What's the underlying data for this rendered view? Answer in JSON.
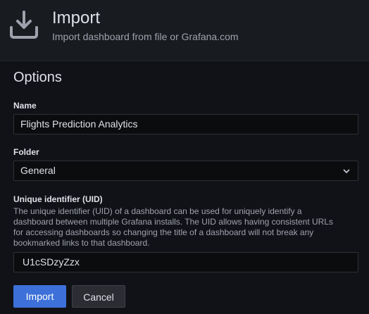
{
  "header": {
    "icon": "download-icon",
    "title": "Import",
    "subtitle": "Import dashboard from file or Grafana.com"
  },
  "options": {
    "title": "Options",
    "name": {
      "label": "Name",
      "value": "Flights Prediction Analytics"
    },
    "folder": {
      "label": "Folder",
      "value": "General",
      "icon": "chevron-down-icon"
    },
    "uid": {
      "label": "Unique identifier (UID)",
      "description_lines": [
        "The unique identifier (UID) of a dashboard can be used for uniquely identify a",
        "dashboard between multiple Grafana installs. The UID allows having consistent URLs",
        "for accessing dashboards so changing the title of a dashboard will not break any",
        "bookmarked links to that dashboard."
      ],
      "value": "U1cSDzyZzx"
    }
  },
  "actions": {
    "import_label": "Import",
    "cancel_label": "Cancel"
  },
  "colors": {
    "background": "#111217",
    "header_background": "#181b1f",
    "primary_button": "#3d71d9",
    "secondary_button": "#2c2d33"
  }
}
